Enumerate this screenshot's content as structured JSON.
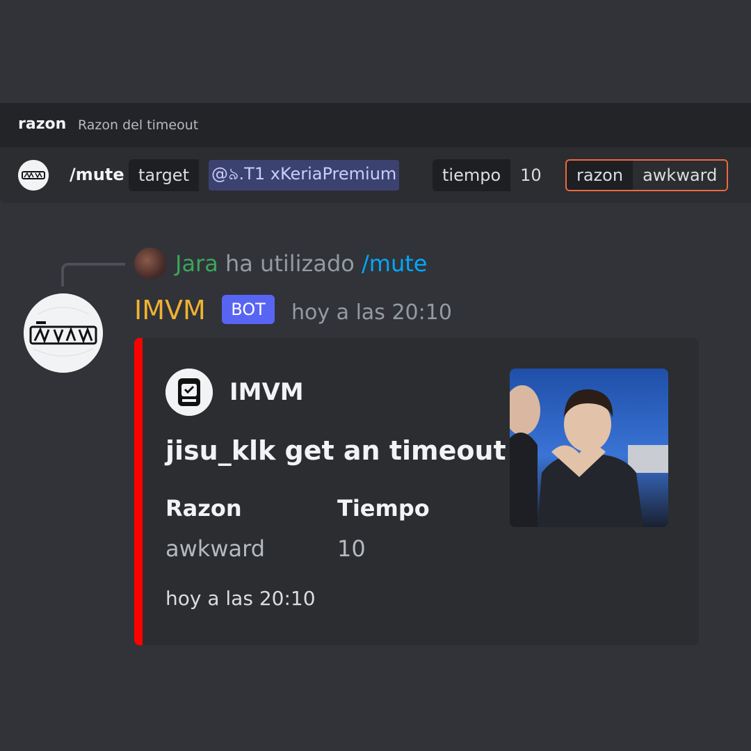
{
  "option_hint": {
    "name": "razon",
    "description": "Razon del timeout"
  },
  "command_input": {
    "command": "/mute",
    "options": [
      {
        "name": "target",
        "value": "@৯.T1 xKeriaPremium",
        "is_mention": true
      },
      {
        "name": "tiempo",
        "value": "10"
      },
      {
        "name": "razon",
        "value": "awkward",
        "active": true
      }
    ]
  },
  "message": {
    "reply": {
      "user": "Jara",
      "action": "ha utilizado",
      "command": "/mute"
    },
    "author": "IMVM",
    "badge": "BOT",
    "timestamp": "hoy a las 20:10",
    "embed": {
      "color": "#ff0000",
      "author_name": "IMVM",
      "title": "jisu_klk get an timeout",
      "fields": [
        {
          "name": "Razon",
          "value": "awkward"
        },
        {
          "name": "Tiempo",
          "value": "10"
        }
      ],
      "footer": "hoy a las 20:10"
    }
  },
  "colors": {
    "background": "#313338",
    "author_name": "#f0b232",
    "reply_user": "#3ba55c",
    "command_link": "#00a8fc",
    "bot_badge": "#5865f2",
    "active_option_border": "#f0683d"
  }
}
